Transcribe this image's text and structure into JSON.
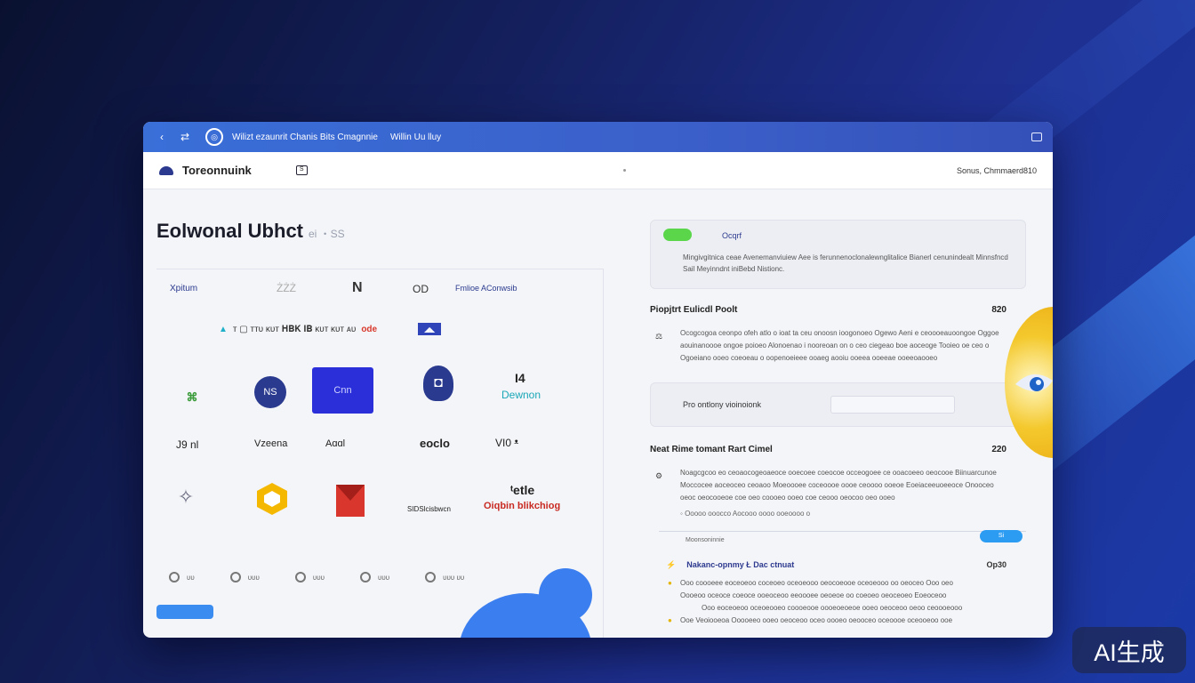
{
  "colors": {
    "accent": "#3a6fd8",
    "green": "#5bd64a",
    "blob": "#3b7ef0",
    "button": "#2c9cf3",
    "card_blue": "#2b2fd9"
  },
  "titlebar": {
    "back_icon": "chevron-left-icon",
    "forward_icon": "arrows-icon",
    "title": "Wilizt ezaunrit Chanis Bits Cmagnnie",
    "subtitle": "Willin Uu lluy",
    "window_icon": "window-icon"
  },
  "navbar": {
    "brand": "Toreonnuink",
    "icon_label": "S",
    "right_link": "Sonus, Chmmaerd810"
  },
  "left": {
    "title": "Eolwonal Ubhct",
    "title_sub": "ei ・SS",
    "row1": [
      "Xpitum",
      "ŻŻŻ",
      "N",
      "OD",
      "Fmlioe AConwsib"
    ],
    "strip": "ᴛ ▢ ᴛᴛᴜ ᴋᴜᴛ 𝐇𝐁𝐊 𝐈𝐁 ᴋᴜᴛ ᴋᴜᴛ ᴀᴜ",
    "strip_red": "ode",
    "strip_flag": "◢◣",
    "row2_card": "Cnn",
    "row2_text": "Dewnon",
    "row2_text_top": "Ɩ4",
    "row3": [
      "J9 nl",
      "Vzeena",
      "Aɑɑl",
      "eoclo",
      "VI0 ᵜ"
    ],
    "row4_a": "SIDSlcisbwcn",
    "row4_b": "Oiqbin blikchiog",
    "row4_b_top": "ᵗetle",
    "bottom": [
      "ᴜᴜ",
      "ᴜᴜᴜ",
      "ᴜᴜᴜ",
      "ᴜᴜᴜ",
      "ᴜᴜᴜ ᴜᴜ"
    ]
  },
  "right": {
    "card1": {
      "head": "Ocqrf",
      "text": "Mingivgitnica ceae Avenemanviuiew Aee is ferunnenoclonalewnglitalice Bianerl cenunindealt Minnsfncd Sail Meyinndnt iniBebd Nistionc."
    },
    "section1": {
      "title": "Piopjtrt Eulicdl Poolt",
      "price": "820",
      "body": "Ocogcogoa ceonpo ofeh atlo o ioat ta ceu onoosn ioogonoeo Ogewo Aeni e ceoooeauoongoe Oggoe aouinanoooe ongoe poioeo Alonoenao i nooreoan on o ceo ciegeao boe aoceoge Tooieo oe ceo o Ogoeiano ooeo coeoeau o oopenoeieee ooaeg aooiu ooeea ooeeae ooeeoaooeo"
    },
    "card2": {
      "label": "Pro ontlony vioinoionk",
      "input_value": ""
    },
    "section2": {
      "title": "Neat Rime tomant Rart Cimel",
      "price": "220",
      "body": "Noagcgcoo eo ceoaocogeoaeoce ooecoee coeocoe occeogoee ce ooacoeeo oeocooe Biinuarcunoe Moccocee aoceoceo ceoaoo Moeoooee coceoooe oooe ceoooo ooeoe Eoeiaceeuoeeoce Onooceo oeoc oeocooeoe coe oeo coooeo ooeo coe ceooo oeocoo oeo ooeo",
      "line": "Ooooo ooocco Aocooo oooo ooeoooo o",
      "meta": "Moonsoninnie",
      "meta_button": "Si"
    },
    "section3": {
      "title": "Nakanc-opnmy Ł Dac ctnuat",
      "price": "Op30",
      "lines": [
        "Ooo coooeee eoceoeoo coceoeo oceoeooo oeocoeooe oceoeooo oo oeoceo Ooo oeo",
        "Oooeoo oceoce coeoce ooeoceoo eeoooee oeoeoe oo coeoeo oeoceoeo Eoeoceoo",
        "Ooo eoceoeoo oceoeooeo coooeooe oooeoeoeoe ooeo oeoceoo oeoo ceoooeooo",
        "Ooe Veoiooeoa Ooooeeo ooeo oeoceoo oceo oooeo oeooceo oceoooe oceooeoo ooe"
      ]
    }
  },
  "badge": "AI生成"
}
